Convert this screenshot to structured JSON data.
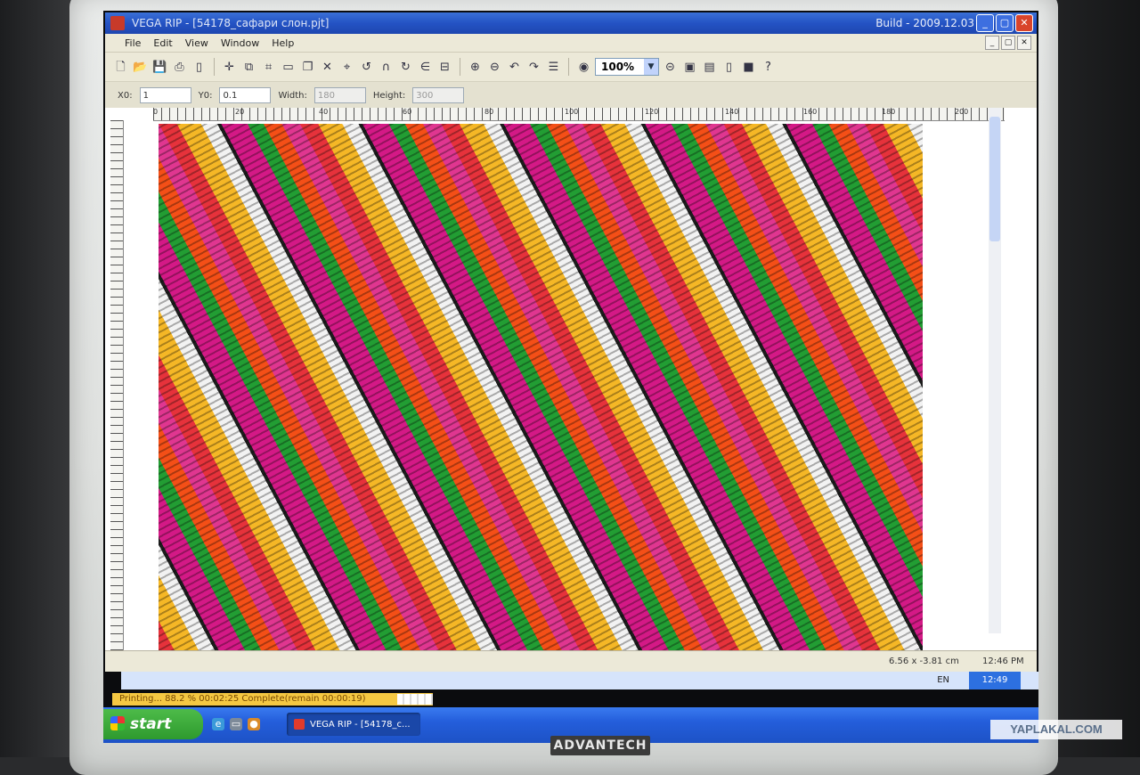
{
  "window": {
    "title": "VEGA RIP - [54178_сафари слон.pjt]",
    "build": "Build - 2009.12.03",
    "minimize": "_",
    "maximize": "▢",
    "close": "✕"
  },
  "menu": {
    "items": [
      "File",
      "Edit",
      "View",
      "Window",
      "Help"
    ],
    "mdi": [
      "_",
      "▢",
      "✕"
    ]
  },
  "toolbar": {
    "zoom_value": "100%"
  },
  "properties": {
    "x_label": "X0:",
    "x_value": "1",
    "y_label": "Y0:",
    "y_value": "0.1",
    "width_label": "Width:",
    "width_value": "180",
    "height_label": "Height:",
    "height_value": "300"
  },
  "ruler": {
    "labels": [
      "0",
      "20",
      "40",
      "60",
      "80",
      "100",
      "120",
      "140",
      "160",
      "180",
      "200"
    ]
  },
  "status": {
    "coords": "6.56 x -3.81 cm",
    "time": "12:46 PM"
  },
  "taskbar": {
    "lang": "EN",
    "clock": "12:49",
    "start_label": "start",
    "task_label": "VEGA RIP - [54178_с...",
    "print_status": "Printing...   88.2 %  00:02:25 Complete(remain 00:00:19)",
    "print_progress": 0.882
  },
  "monitor": {
    "brand": "ADVANTECH"
  },
  "watermark": "YAPLAKAL.COM"
}
